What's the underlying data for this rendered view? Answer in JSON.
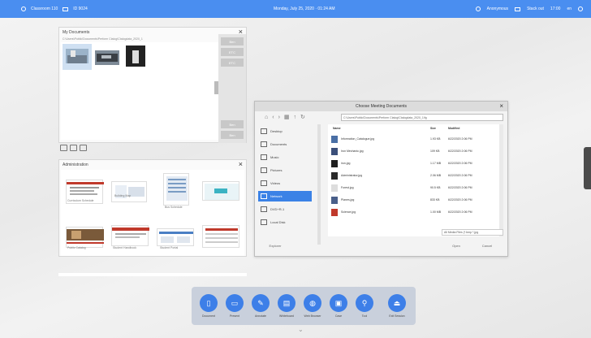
{
  "topbar": {
    "left_label": "Classroom 110",
    "left_sub": "ID 9024",
    "datetime": "Monday, July 25, 2020 · 01:24 AM",
    "right_user": "Anonymous",
    "right_status": "Stack out",
    "right_time": "17:00",
    "right_extra": "en"
  },
  "mydocs": {
    "title": "My Documents",
    "path": "C:\\Users\\Public\\Documents\\Perform Ctalog\\Ctalogdata_2020_1",
    "side_buttons": [
      "Ben",
      "ETC",
      "ETC"
    ],
    "bottom_buttons": [
      "Ben",
      "Ben"
    ]
  },
  "admin": {
    "title": "Administration",
    "thumb_labels": [
      "Curriculum Schedule",
      "Building Map",
      "Bus Schedule",
      "",
      "Public Catalog",
      "Student Handbook",
      "Student Portal",
      ""
    ]
  },
  "dialog": {
    "title": "Choose Meeting Documents",
    "path": "C:\\Users\\Public\\Documents\\Perform Ctalog\\Ctalogdata_2020_1\\fg",
    "nav": [
      "Desktop",
      "Documents",
      "Music",
      "Pictures",
      "Videos",
      "Network",
      "DVD+R-1",
      "Local Disk"
    ],
    "columns": {
      "name": "Name",
      "size": "Size",
      "modified": "Modified"
    },
    "files": [
      {
        "name": "Information_Catalogue.jpg",
        "size": "1.93 KB",
        "modified": "6/22/2020 2:06 PM",
        "color": "#4a6fa5"
      },
      {
        "name": "Iron Mechanic.jpg",
        "size": "109 KB",
        "modified": "6/22/2020 2:06 PM",
        "color": "#3b4f7a"
      },
      {
        "name": "iron.jpg",
        "size": "1.17 MB",
        "modified": "6/22/2020 2:06 PM",
        "color": "#1f1f1f"
      },
      {
        "name": "Administrator.jpg",
        "size": "2.06 MB",
        "modified": "6/22/2020 2:06 PM",
        "color": "#2a2a2a"
      },
      {
        "name": "Forest.jpg",
        "size": "90.5 KB",
        "modified": "6/22/2020 2:06 PM",
        "color": "#dddddd"
      },
      {
        "name": "Planes.jpg",
        "size": "833 KB",
        "modified": "6/22/2020 2:06 PM",
        "color": "#4a5f8a"
      },
      {
        "name": "Science.jpg",
        "size": "1.00 MB",
        "modified": "6/22/2020 2:06 PM",
        "color": "#c0392b"
      }
    ],
    "filter": "All Media Files (*.bmp *.jpg",
    "explorer_label": "Explorer",
    "open_label": "Open",
    "cancel_label": "Cancel"
  },
  "dock": {
    "buttons": [
      {
        "label": "Document",
        "icon": "document-icon"
      },
      {
        "label": "Present",
        "icon": "present-icon"
      },
      {
        "label": "Annotate",
        "icon": "pen-icon"
      },
      {
        "label": "Whiteboard",
        "icon": "whiteboard-icon"
      },
      {
        "label": "Web Browser",
        "icon": "globe-icon"
      },
      {
        "label": "Case",
        "icon": "case-icon"
      },
      {
        "label": "Tool",
        "icon": "tool-icon"
      },
      {
        "label": "Exit Session",
        "icon": "exit-icon"
      }
    ]
  },
  "colors": {
    "accent": "#4a8ef0",
    "dock_button": "#3d7fe8",
    "selection": "#3b82e6"
  }
}
